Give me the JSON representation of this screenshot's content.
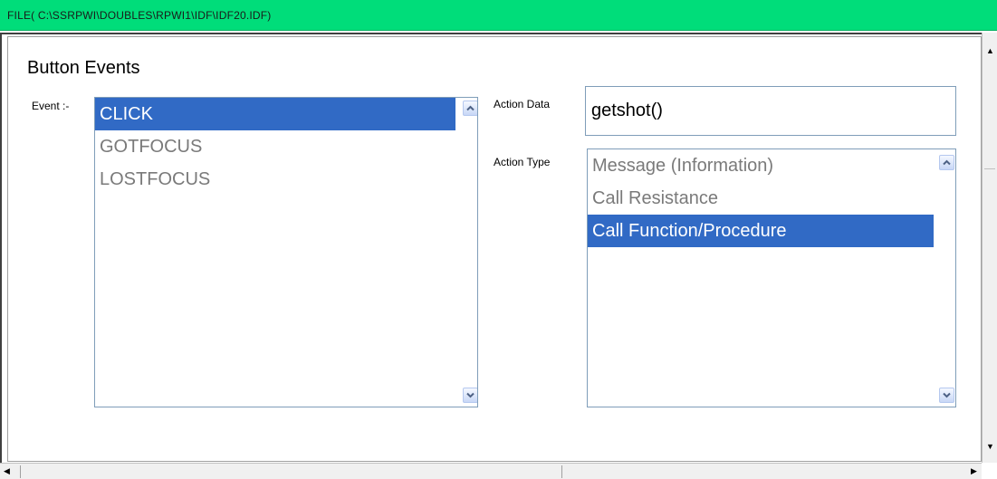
{
  "window": {
    "title": "FILE( C:\\SSRPWI\\DOUBLES\\RPWI1\\IDF\\IDF20.IDF)"
  },
  "section": {
    "heading": "Button Events"
  },
  "event": {
    "label": "Event :-",
    "items": [
      {
        "label": "CLICK",
        "selected": true
      },
      {
        "label": "GOTFOCUS",
        "selected": false
      },
      {
        "label": "LOSTFOCUS",
        "selected": false
      }
    ]
  },
  "action_data": {
    "label": "Action Data",
    "value": "getshot()"
  },
  "action_type": {
    "label": "Action Type",
    "items": [
      {
        "label": "Message (Information)",
        "selected": false
      },
      {
        "label": "Call Resistance",
        "selected": false
      },
      {
        "label": "Call Function/Procedure",
        "selected": true
      }
    ]
  },
  "colors": {
    "titlebar": "#00dd7a",
    "selection": "#316ac5",
    "unselected_text": "#7a7a7a"
  }
}
